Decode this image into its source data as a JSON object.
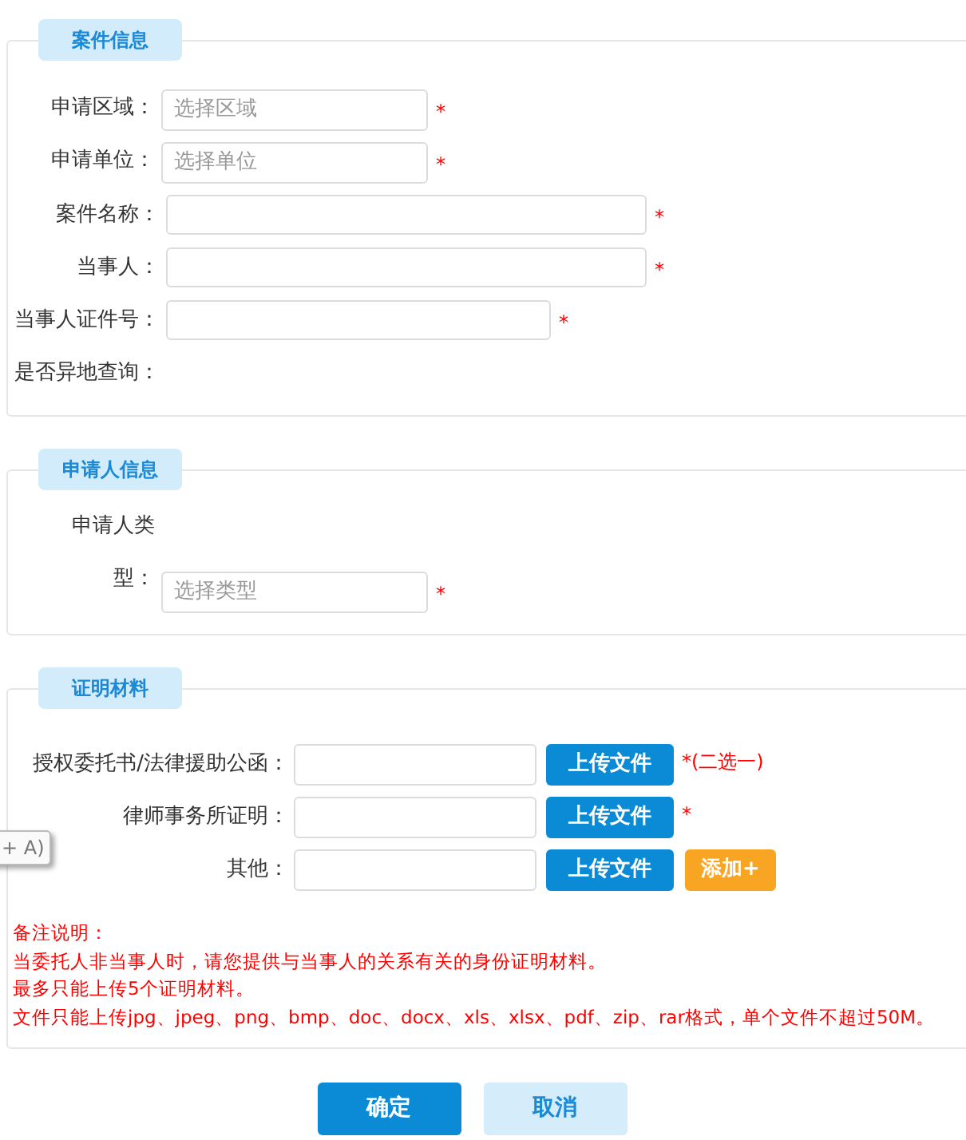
{
  "sections": [
    {
      "title": "案件信息",
      "rows": [
        {
          "kind": "select",
          "label": "申请区域：",
          "placeholder": "选择区域",
          "required": true
        },
        {
          "kind": "select",
          "label": "申请单位：",
          "placeholder": "选择单位",
          "required": true
        },
        {
          "kind": "text",
          "label": "案件名称：",
          "required": true
        },
        {
          "kind": "text",
          "label": "当事人：",
          "required": true
        },
        {
          "kind": "id",
          "label": "当事人证件号：",
          "required": true
        },
        {
          "kind": "plain",
          "label": "是否异地查询："
        }
      ]
    },
    {
      "title": "申请人信息",
      "rows": [
        {
          "kind": "wrapselect",
          "label": "申请人类型：",
          "placeholder": "选择类型",
          "required": true
        }
      ]
    },
    {
      "title": "证明材料",
      "rows": [
        {
          "kind": "file",
          "label": "授权委托书/法律援助公函：",
          "button": "上传文件",
          "note": "*(二选一)"
        },
        {
          "kind": "file",
          "label": "律师事务所证明：",
          "button": "上传文件",
          "note": "*"
        },
        {
          "kind": "file",
          "label": "其他：",
          "button": "上传文件",
          "add": "添加+"
        }
      ],
      "notes": [
        "备注说明：",
        "当委托人非当事人时，请您提供与当事人的关系有关的身份证明材料。",
        "最多只能上传5个证明材料。",
        "文件只能上传jpg、jpeg、png、bmp、doc、docx、xls、xlsx、pdf、zip、rar格式，单个文件不超过50M。"
      ]
    }
  ],
  "tooltip": "+ A)",
  "buttons": [
    {
      "label": "确定",
      "kind": "primary"
    },
    {
      "label": "取消",
      "kind": "secondary"
    }
  ]
}
